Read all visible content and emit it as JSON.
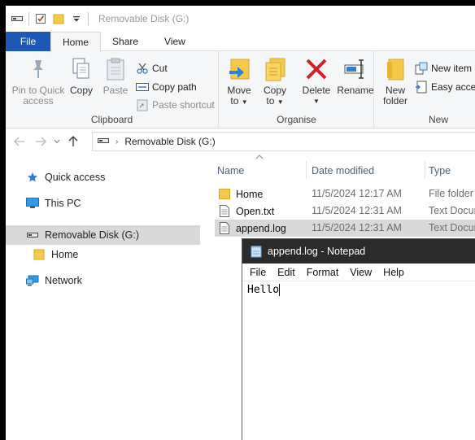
{
  "window": {
    "title": "Removable Disk (G:)"
  },
  "ribbon_tabs": [
    "File",
    "Home",
    "Share",
    "View"
  ],
  "clipboard": {
    "pin_label_1": "Pin to Quick",
    "pin_label_2": "access",
    "copy_label": "Copy",
    "paste_label": "Paste",
    "cut_label": "Cut",
    "copy_path_label": "Copy path",
    "paste_shortcut_label": "Paste shortcut",
    "group_label": "Clipboard"
  },
  "organise": {
    "move_to_1": "Move",
    "move_to_2": "to",
    "copy_to_1": "Copy",
    "copy_to_2": "to",
    "delete_label": "Delete",
    "rename_label": "Rename",
    "group_label": "Organise"
  },
  "new_group": {
    "new_folder_1": "New",
    "new_folder_2": "folder",
    "new_item": "New item",
    "easy_access": "Easy access",
    "group_label": "New"
  },
  "address": {
    "path": "Removable Disk (G:)"
  },
  "nav": {
    "quick_access": "Quick access",
    "this_pc": "This PC",
    "removable_disk": "Removable Disk (G:)",
    "home": "Home",
    "network": "Network"
  },
  "columns": {
    "name": "Name",
    "date": "Date modified",
    "type": "Type"
  },
  "files": [
    {
      "name": "Home",
      "date": "11/5/2024 12:17 AM",
      "type": "File folder",
      "icon": "folder-icon"
    },
    {
      "name": "Open.txt",
      "date": "11/5/2024 12:31 AM",
      "type": "Text Docum",
      "icon": "text-file-icon"
    },
    {
      "name": "append.log",
      "date": "11/5/2024 12:31 AM",
      "type": "Text Docum",
      "icon": "text-file-icon"
    }
  ],
  "notepad": {
    "title": "append.log - Notepad",
    "menu": [
      "File",
      "Edit",
      "Format",
      "View",
      "Help"
    ],
    "content": "Hello"
  },
  "colors": {
    "file_tab": "#1e5ab5",
    "selected_bg": "#d9d9d9",
    "delete_red": "#d4202a",
    "folder_yellow": "#f7c948"
  }
}
